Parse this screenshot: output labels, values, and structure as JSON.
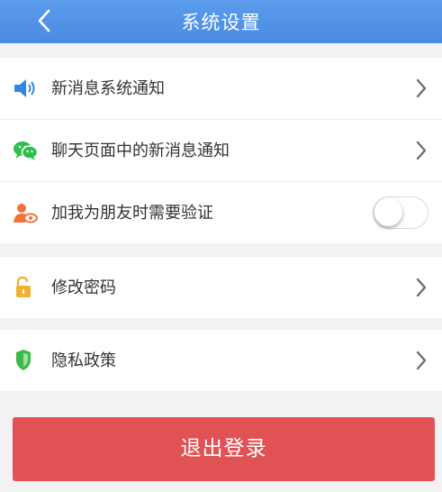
{
  "header": {
    "title": "系统设置",
    "back_icon": "chevron-left-icon"
  },
  "settings": {
    "notify_label": "新消息系统通知",
    "chat_notify_label": "聊天页面中的新消息通知",
    "verify_label": "加我为朋友时需要验证",
    "verify_enabled": false,
    "password_label": "修改密码",
    "privacy_label": "隐私政策"
  },
  "icons": {
    "notify": "speaker-icon",
    "chat": "wechat-icon",
    "verify": "user-eye-icon",
    "password": "unlock-icon",
    "privacy": "shield-icon"
  },
  "colors": {
    "header": "#4a8be2",
    "logout": "#e05254",
    "speaker": "#2f86e6",
    "chat": "#2cbf4c",
    "verify": "#f0733a",
    "lock": "#f2b230",
    "shield": "#3cb84a"
  },
  "footer": {
    "logout_label": "退出登录"
  }
}
